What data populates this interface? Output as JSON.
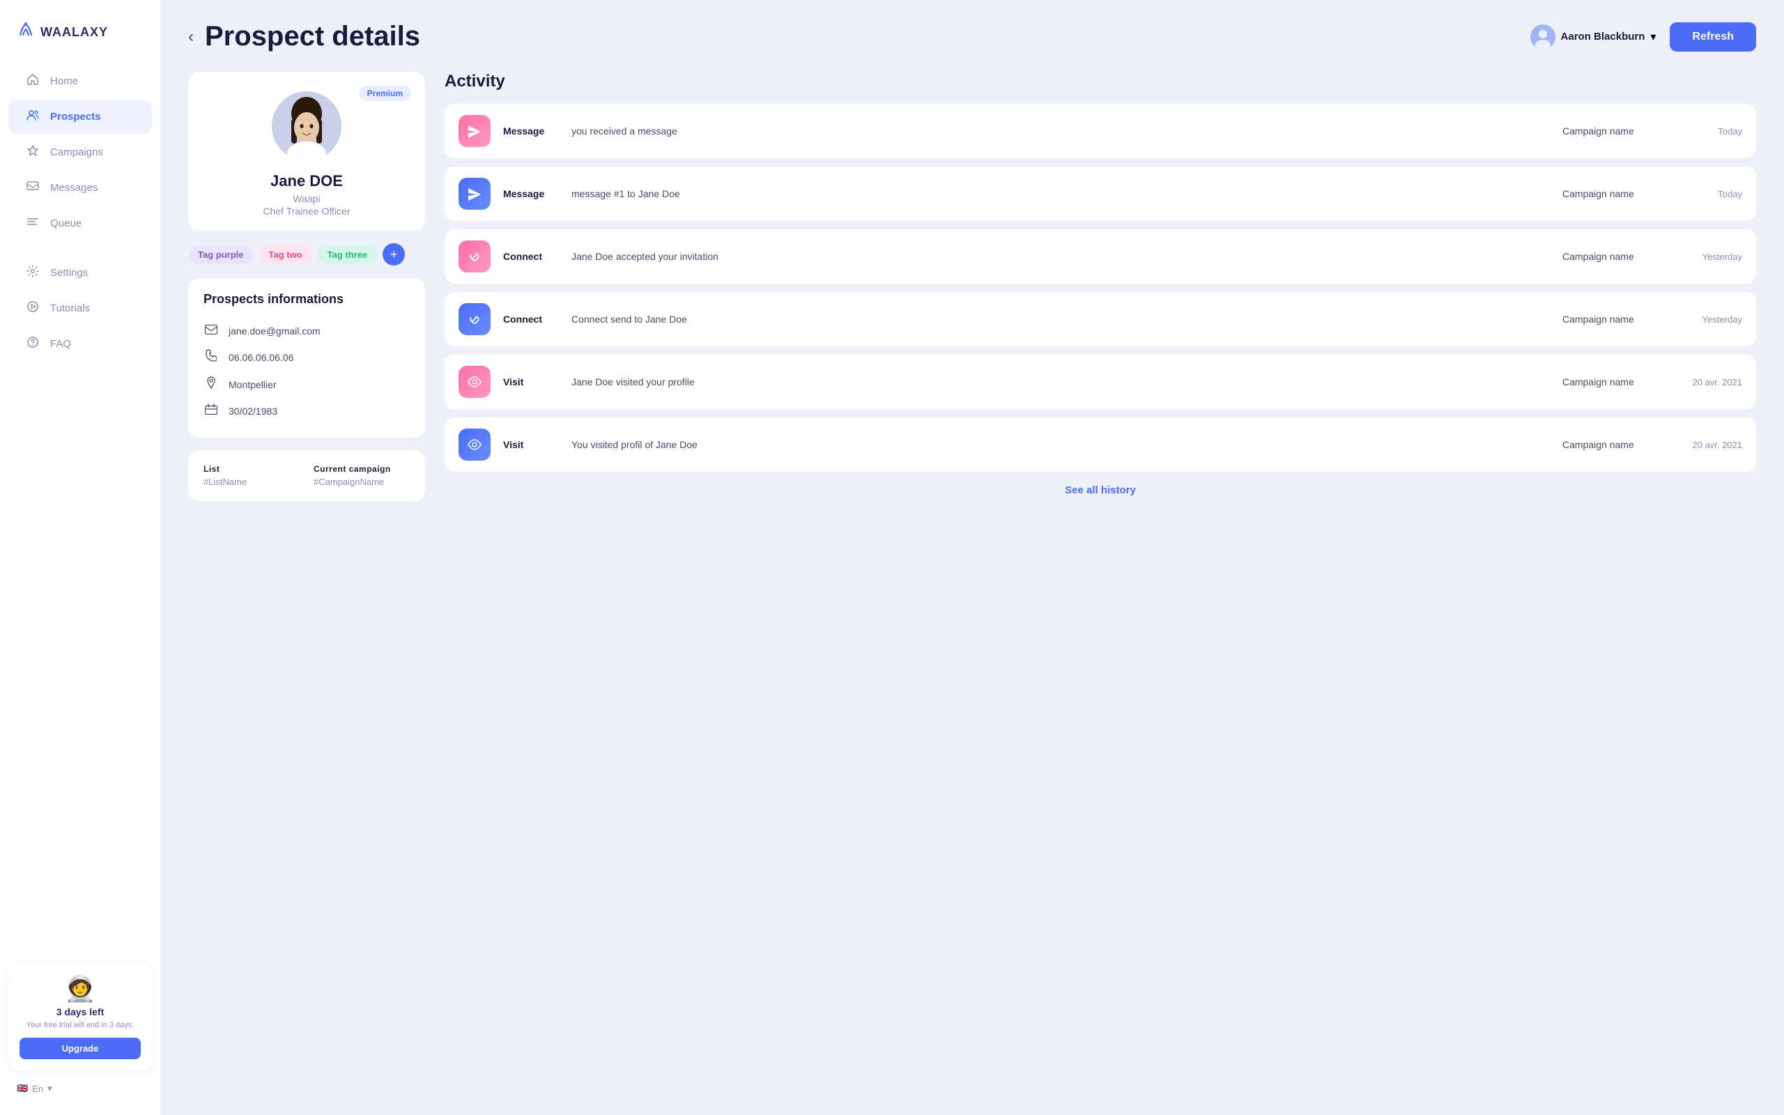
{
  "sidebar": {
    "logo": "WAALAXY",
    "nav_items": [
      {
        "id": "home",
        "label": "Home",
        "icon": "🏠",
        "active": false
      },
      {
        "id": "prospects",
        "label": "Prospects",
        "icon": "👥",
        "active": true
      },
      {
        "id": "campaigns",
        "label": "Campaigns",
        "icon": "🚀",
        "active": false
      },
      {
        "id": "messages",
        "label": "Messages",
        "icon": "✉️",
        "active": false
      },
      {
        "id": "queue",
        "label": "Queue",
        "icon": "☰",
        "active": false
      },
      {
        "id": "settings",
        "label": "Settings",
        "icon": "⚙️",
        "active": false
      },
      {
        "id": "tutorials",
        "label": "Tutorials",
        "icon": "▶️",
        "active": false
      },
      {
        "id": "faq",
        "label": "FAQ",
        "icon": "❓",
        "active": false
      }
    ],
    "trial": {
      "days_left": "3 days left",
      "subtitle": "Your free trial will end in 3 days.",
      "upgrade_label": "Upgrade"
    },
    "language": "En"
  },
  "header": {
    "back_label": "‹",
    "title": "Prospect details",
    "refresh_label": "Refresh",
    "user": {
      "name": "Aaron Blackburn",
      "chevron": "▾"
    }
  },
  "profile": {
    "premium_badge": "Premium",
    "name": "Jane DOE",
    "company": "Waapi",
    "role": "Chef Trainee Officer",
    "tags": [
      {
        "label": "Tag purple",
        "style": "purple"
      },
      {
        "label": "Tag two",
        "style": "pink"
      },
      {
        "label": "Tag three",
        "style": "green"
      }
    ],
    "add_tag_label": "+"
  },
  "prospect_info": {
    "title": "Prospects informations",
    "email": "jane.doe@gmail.com",
    "phone": "06.06.06.06.06",
    "location": "Montpellier",
    "birthday": "30/02/1983"
  },
  "list_section": {
    "list_label": "List",
    "list_value": "#ListName",
    "campaign_label": "Current campaign",
    "campaign_value": "#CampaignName"
  },
  "activity": {
    "title": "Activity",
    "items": [
      {
        "icon": "✈",
        "icon_style": "pink",
        "type": "Message",
        "description": "you received a message",
        "campaign": "Campaign name",
        "time": "Today"
      },
      {
        "icon": "✈",
        "icon_style": "blue",
        "type": "Message",
        "description": "message #1 to Jane Doe",
        "campaign": "Campaign name",
        "time": "Today"
      },
      {
        "icon": "🔗",
        "icon_style": "link-pink",
        "type": "Connect",
        "description": "Jane Doe accepted your invitation",
        "campaign": "Campaign name",
        "time": "Yesterday"
      },
      {
        "icon": "🔗",
        "icon_style": "link-blue",
        "type": "Connect",
        "description": "Connect send to Jane Doe",
        "campaign": "Campaign name",
        "time": "Yesterday"
      },
      {
        "icon": "👁",
        "icon_style": "eye-pink",
        "type": "Visit",
        "description": "Jane Doe visited your profile",
        "campaign": "Campaign name",
        "time": "20 avr. 2021"
      },
      {
        "icon": "👁",
        "icon_style": "eye-blue",
        "type": "Visit",
        "description": "You visited profil of Jane Doe",
        "campaign": "Campaign name",
        "time": "20 avr. 2021"
      }
    ],
    "see_all_label": "See all history"
  }
}
